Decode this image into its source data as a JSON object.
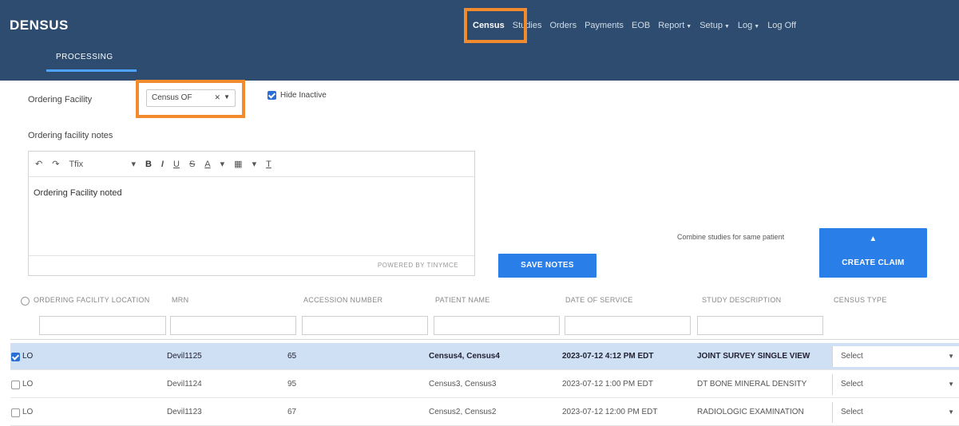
{
  "app": {
    "title": "DENSUS"
  },
  "nav": {
    "items": [
      {
        "label": "Census",
        "active": true
      },
      {
        "label": "Studies"
      },
      {
        "label": "Orders"
      },
      {
        "label": "Payments"
      },
      {
        "label": "EOB"
      },
      {
        "label": "Report",
        "dropdown": true
      },
      {
        "label": "Setup",
        "dropdown": true
      },
      {
        "label": "Log",
        "dropdown": true
      },
      {
        "label": "Log Off"
      }
    ]
  },
  "subnav": {
    "tab": "PROCESSING"
  },
  "facility": {
    "label": "Ordering Facility",
    "selected": "Census OF",
    "clear_icon": "x-icon",
    "hide_inactive_label": "Hide Inactive",
    "hide_inactive_checked": true
  },
  "notes": {
    "label": "Ordering facility notes",
    "toolbar": {
      "font": "Tfix",
      "undo_icon": "undo-icon",
      "redo_icon": "redo-icon"
    },
    "content": "Ordering Facility noted",
    "powered_by": "POWERED BY TINYMCE",
    "save_label": "SAVE NOTES"
  },
  "combine": {
    "label": "Combine studies for same patient",
    "checked": true
  },
  "create_claim": {
    "label": "CREATE CLAIM",
    "icon": "user-icon"
  },
  "grid": {
    "columns": [
      "ORDERING FACILITY LOCATION",
      "MRN",
      "ACCESSION NUMBER",
      "PATIENT NAME",
      "DATE OF SERVICE",
      "STUDY DESCRIPTION",
      "CENSUS TYPE"
    ],
    "rows": [
      {
        "selected": true,
        "location": "LO",
        "mrn": "Devil1125",
        "accession": "65",
        "patient": "Census4, Census4",
        "date": "2023-07-12 4:12 PM EDT",
        "study": "JOINT SURVEY SINGLE VIEW",
        "type": "Select"
      },
      {
        "selected": false,
        "location": "LO",
        "mrn": "Devil1124",
        "accession": "95",
        "patient": "Census3, Census3",
        "date": "2023-07-12 1:00 PM EDT",
        "study": "DT BONE MINERAL DENSITY",
        "type": "Select"
      },
      {
        "selected": false,
        "location": "LO",
        "mrn": "Devil1123",
        "accession": "67",
        "patient": "Census2, Census2",
        "date": "2023-07-12 12:00 PM EDT",
        "study": "RADIOLOGIC EXAMINATION",
        "type": "Select"
      }
    ]
  },
  "colors": {
    "header": "#2d4c6f",
    "accent": "#2a7ee8",
    "highlight": "#f28a2e",
    "selected_row": "#cfe0f4"
  }
}
